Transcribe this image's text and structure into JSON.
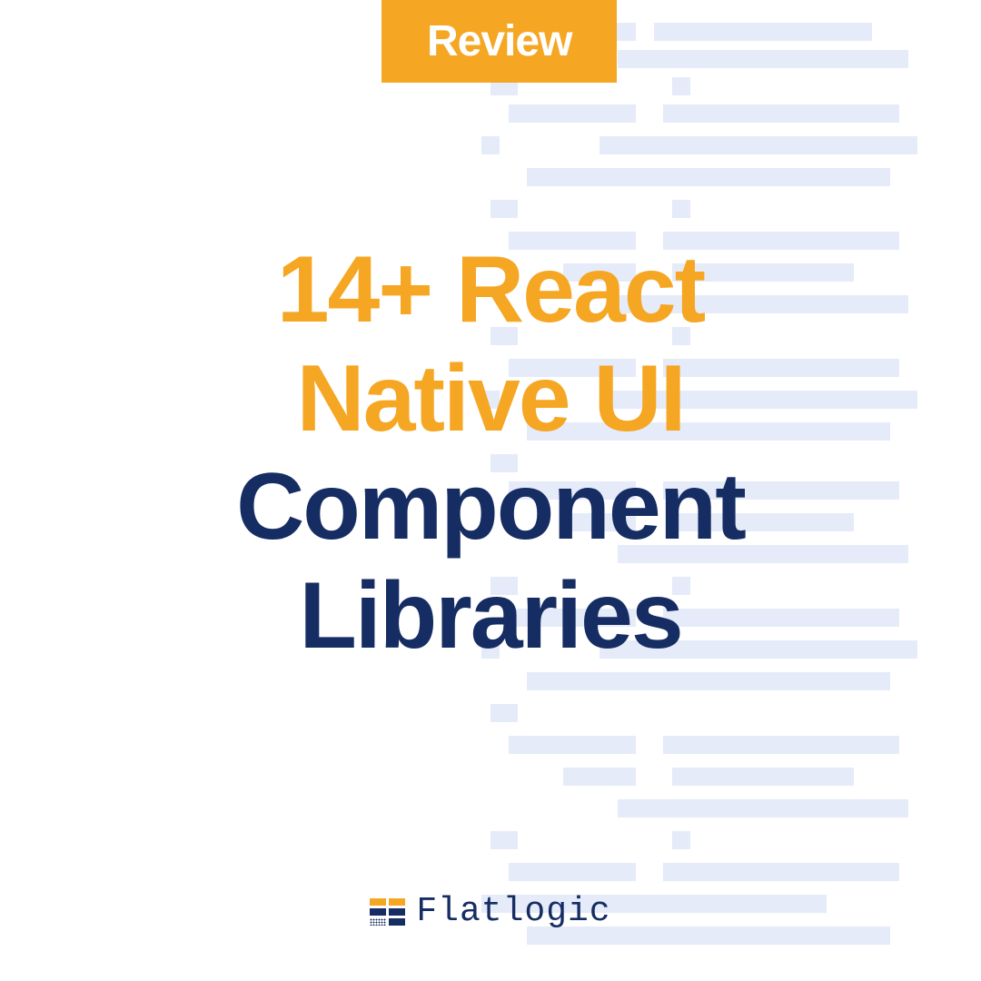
{
  "badge": {
    "label": "Review"
  },
  "title": {
    "line1": "14+ React",
    "line2": "Native UI",
    "line3": "Component",
    "line4": "Libraries"
  },
  "logo": {
    "text": "Flatlogic"
  },
  "colors": {
    "accent_orange": "#f5a623",
    "navy": "#162d63",
    "light_blue": "#e5ebf9",
    "white": "#ffffff"
  }
}
